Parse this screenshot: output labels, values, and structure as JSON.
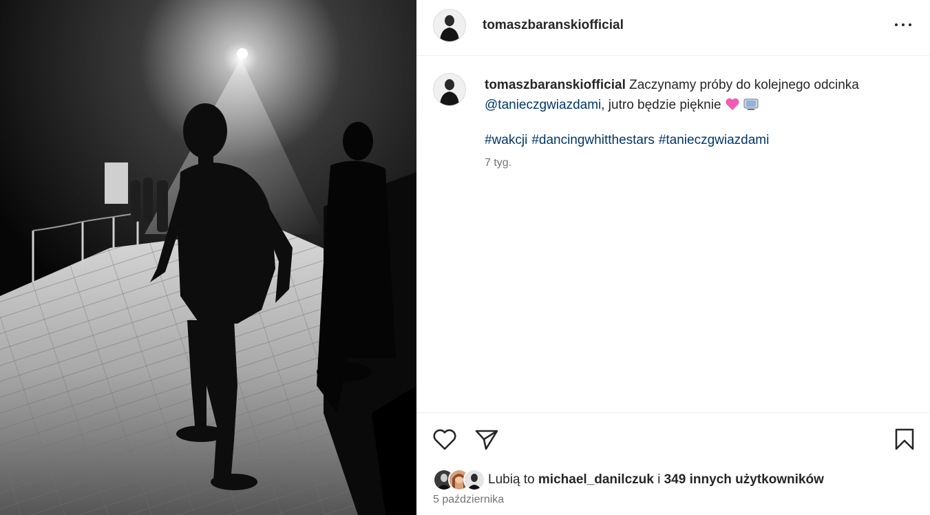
{
  "post": {
    "username": "tomaszbaranskiofficial",
    "caption_user": "tomaszbaranskiofficial",
    "caption_text_1": "Zaczynamy próby do kolejnego odcinka",
    "caption_mention": "@tanieczgwiazdami",
    "caption_text_2": ", jutro będzie pięknie",
    "hashtags": [
      "#wakcji",
      "#dancingwhitthestars",
      "#tanieczgwiazdami"
    ],
    "time_ago": "7 tyg.",
    "likes_prefix": "Lubią to",
    "likes_user": "michael_danilczuk",
    "likes_mid": "i",
    "likes_count": "349 innych użytkowników",
    "date": "5 października"
  },
  "icons": {
    "more": "more-options-icon",
    "like": "heart-icon",
    "share": "paper-plane-icon",
    "save": "bookmark-icon",
    "emoji_1": "pink-heart-emoji",
    "emoji_2": "tv-emoji"
  },
  "colors": {
    "link": "#00376b",
    "muted": "#737373",
    "text": "#262626",
    "pink_heart": "#f25bb4"
  }
}
